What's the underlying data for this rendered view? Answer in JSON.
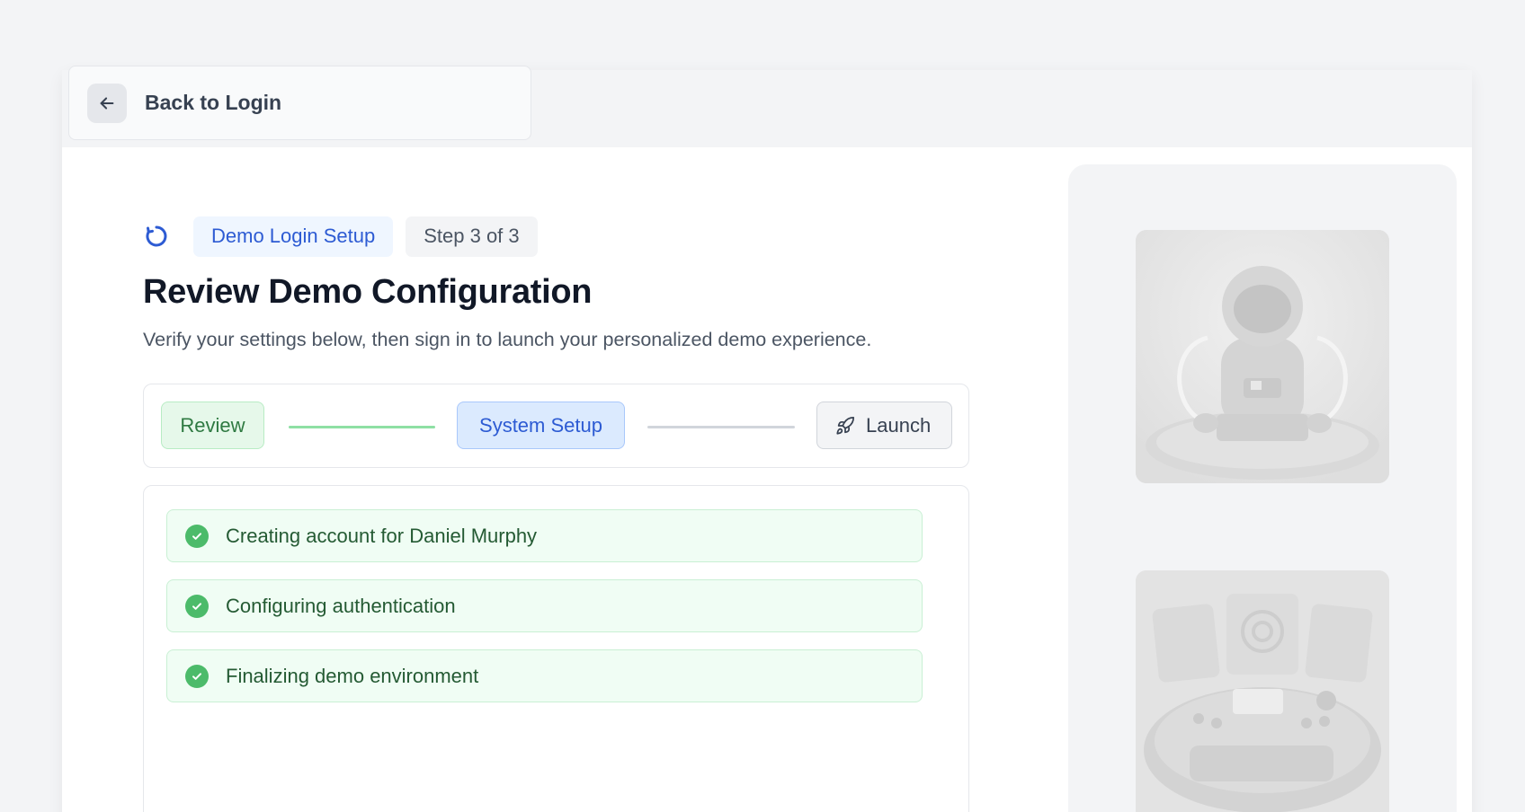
{
  "back": {
    "label": "Back to Login",
    "icon": "arrow-left-icon"
  },
  "header": {
    "status_icon": "loading-spinner-icon",
    "badge_primary": "Demo Login Setup",
    "badge_step": "Step 3 of 3",
    "title": "Review Demo Configuration",
    "subtitle": "Verify your settings below, then sign in to launch your personalized demo experience."
  },
  "stepper": {
    "steps": [
      {
        "label": "Review",
        "state": "complete"
      },
      {
        "label": "System Setup",
        "state": "active"
      },
      {
        "label": "Launch",
        "state": "pending",
        "icon": "rocket-icon"
      }
    ]
  },
  "tasks": [
    {
      "label": "Creating account for Daniel Murphy",
      "status": "done"
    },
    {
      "label": "Configuring authentication",
      "status": "done"
    },
    {
      "label": "Finalizing demo environment",
      "status": "done"
    }
  ],
  "colors": {
    "accent_blue": "#2d5bd3",
    "success_green": "#4cbb6a",
    "success_bg": "#f0fdf4"
  }
}
